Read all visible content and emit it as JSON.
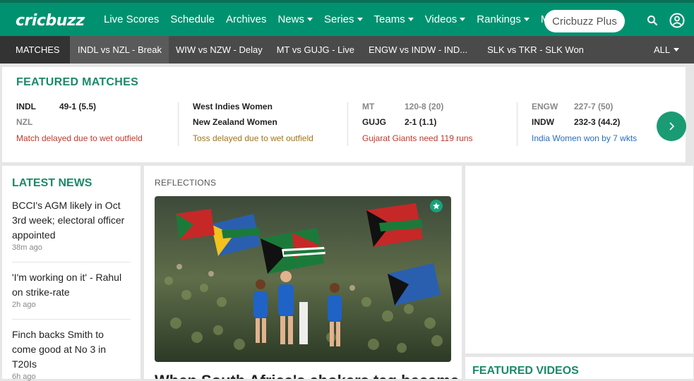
{
  "brand": {
    "name": "cricbuzz",
    "color": "#009270"
  },
  "nav": {
    "items": [
      {
        "label": "Live Scores",
        "dropdown": false
      },
      {
        "label": "Schedule",
        "dropdown": false
      },
      {
        "label": "Archives",
        "dropdown": false
      },
      {
        "label": "News",
        "dropdown": true
      },
      {
        "label": "Series",
        "dropdown": true
      },
      {
        "label": "Teams",
        "dropdown": true
      },
      {
        "label": "Videos",
        "dropdown": true
      },
      {
        "label": "Rankings",
        "dropdown": true
      },
      {
        "label": "More",
        "dropdown": true
      }
    ],
    "plus_button": "Cricbuzz Plus",
    "icons": [
      "search-icon",
      "user-account-icon"
    ]
  },
  "strip": {
    "matches_label": "MATCHES",
    "items": [
      "INDL vs NZL - Break",
      "WIW vs NZW - Delay",
      "MT vs GUJG - Live",
      "ENGW vs INDW - IND...",
      "SLK vs TKR - SLK Won"
    ],
    "all_label": "ALL"
  },
  "featured": {
    "title": "FEATURED MATCHES",
    "matches": [
      {
        "team1": "INDL",
        "score1": "49-1 (5.5)",
        "team1_dim": false,
        "team2": "NZL",
        "score2": "",
        "team2_dim": true,
        "status": "Match delayed due to wet outfield",
        "status_color": "#c0392b"
      },
      {
        "team1": "West Indies Women",
        "score1": "",
        "team1_dim": false,
        "team2": "New Zealand Women",
        "score2": "",
        "team2_dim": false,
        "status": "Toss delayed due to wet outfield",
        "status_color": "#a0741a"
      },
      {
        "team1": "MT",
        "score1": "120-8 (20)",
        "team1_dim": true,
        "team2": "GUJG",
        "score2": "2-1 (1.1)",
        "team2_dim": false,
        "status": "Gujarat Giants need 119 runs",
        "status_color": "#c0392b"
      },
      {
        "team1": "ENGW",
        "score1": "227-7 (50)",
        "team1_dim": true,
        "team2": "INDW",
        "score2": "232-3 (44.2)",
        "team2_dim": false,
        "status": "India Women won by 7 wkts",
        "status_color": "#2b6cc4"
      }
    ]
  },
  "latest_news": {
    "title": "LATEST NEWS",
    "items": [
      {
        "headline": "BCCI's AGM likely in Oct 3rd week; electoral officer appointed",
        "time": "38m ago"
      },
      {
        "headline": "'I'm working on it' - Rahul on strike-rate",
        "time": "2h ago"
      },
      {
        "headline": "Finch backs Smith to come good at No 3 in T20Is",
        "time": "6h ago"
      }
    ]
  },
  "story": {
    "tag": "REFLECTIONS",
    "headline": "When South Africa's chokers tag became..."
  },
  "featured_videos": {
    "title": "FEATURED VIDEOS"
  }
}
